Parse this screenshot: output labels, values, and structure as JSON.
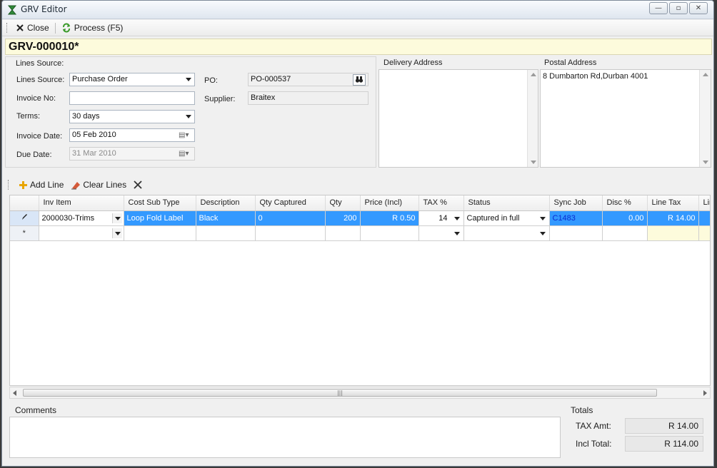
{
  "window": {
    "title": "GRV Editor",
    "controls": {
      "minimize": "—",
      "maximize": "▫",
      "close": "✕"
    }
  },
  "toolbar": {
    "close_label": "Close",
    "process_label": "Process (F5)"
  },
  "document": {
    "number": "GRV-000010*"
  },
  "lines_source_group": {
    "title": "Lines Source:",
    "lines_source_label": "Lines Source:",
    "lines_source_value": "Purchase Order",
    "invoice_no_label": "Invoice No:",
    "invoice_no_value": "",
    "terms_label": "Terms:",
    "terms_value": "30 days",
    "invoice_date_label": "Invoice Date:",
    "invoice_date_value": "05 Feb 2010",
    "due_date_label": "Due Date:",
    "due_date_value": "31 Mar 2010",
    "po_label": "PO:",
    "po_value": "PO-000537",
    "supplier_label": "Supplier:",
    "supplier_value": "Braitex"
  },
  "delivery_address": {
    "title": "Delivery Address",
    "value": ""
  },
  "postal_address": {
    "title": "Postal Address",
    "value": "8 Dumbarton Rd,Durban 4001"
  },
  "lines_toolbar": {
    "add_line": "Add Line",
    "clear_lines": "Clear Lines"
  },
  "grid": {
    "columns": [
      "Inv Item",
      "Cost Sub Type",
      "Description",
      "Qty Captured",
      "Qty",
      "Price (Incl)",
      "TAX %",
      "Status",
      "Sync Job",
      "Disc %",
      "Line Tax",
      "Lin"
    ],
    "rows": [
      {
        "inv_item": "2000030-Trims",
        "cost_sub_type": "Loop Fold Label",
        "description": "Black",
        "qty_captured": "0",
        "qty": "200",
        "price_incl": "R 0.50",
        "tax_pct": "14",
        "status": "Captured in full",
        "sync_job": "C1483",
        "disc_pct": "0.00",
        "line_tax": "R 14.00"
      }
    ],
    "new_row_marker": "*"
  },
  "comments": {
    "title": "Comments",
    "value": ""
  },
  "totals": {
    "title": "Totals",
    "tax_amt_label": "TAX Amt:",
    "tax_amt_value": "R 14.00",
    "incl_total_label": "Incl Total:",
    "incl_total_value": "R 114.00"
  },
  "colors": {
    "selection": "#3399ff",
    "doc_bar": "#fdfbdc",
    "sync_link": "#0a2bd1"
  }
}
